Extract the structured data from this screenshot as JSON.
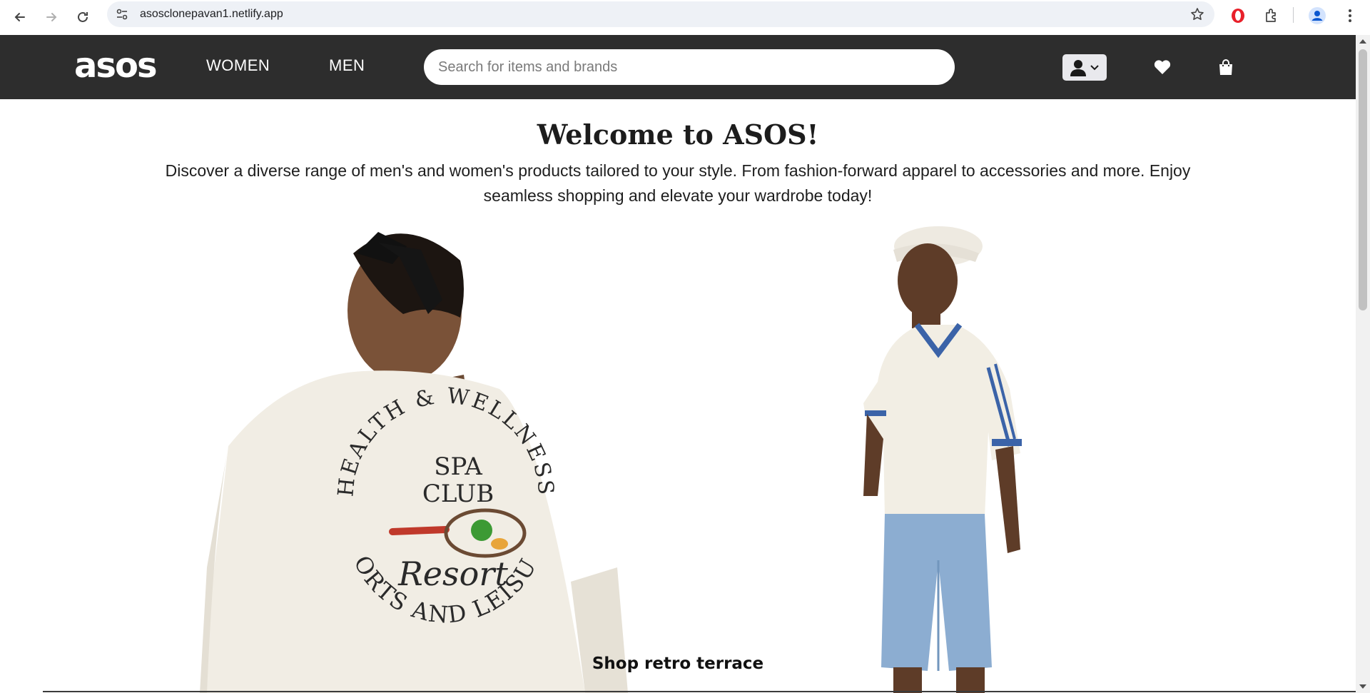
{
  "browser": {
    "url": "asosclonepavan1.netlify.app",
    "icons": [
      "back-icon",
      "forward-icon",
      "reload-icon",
      "site-info-icon",
      "bookmark-star-icon",
      "opera-extension-icon",
      "extensions-puzzle-icon",
      "profile-icon",
      "more-menu-icon"
    ]
  },
  "header": {
    "logo": "asos",
    "nav": [
      "WOMEN",
      "MEN"
    ],
    "search_placeholder": "Search for items and brands",
    "icons": [
      "account-icon",
      "chevron-down-icon",
      "wishlist-heart-icon",
      "shopping-bag-icon"
    ],
    "background": "#2d2d2d"
  },
  "main": {
    "title": "Welcome to ASOS!",
    "intro": "Discover a diverse range of men's and women's products tailored to your style. From fashion-forward apparel to accessories and more. Enjoy seamless shopping and elevate your wardrobe today!",
    "shop_label": "Shop retro terrace",
    "hero_left_print": {
      "arc_top": "HEALTH & WELLNESS",
      "center_lines": [
        "SPA",
        "CLUB"
      ],
      "script": "Resort",
      "arc_bottom": "SPORTS AND LEISURE"
    }
  }
}
